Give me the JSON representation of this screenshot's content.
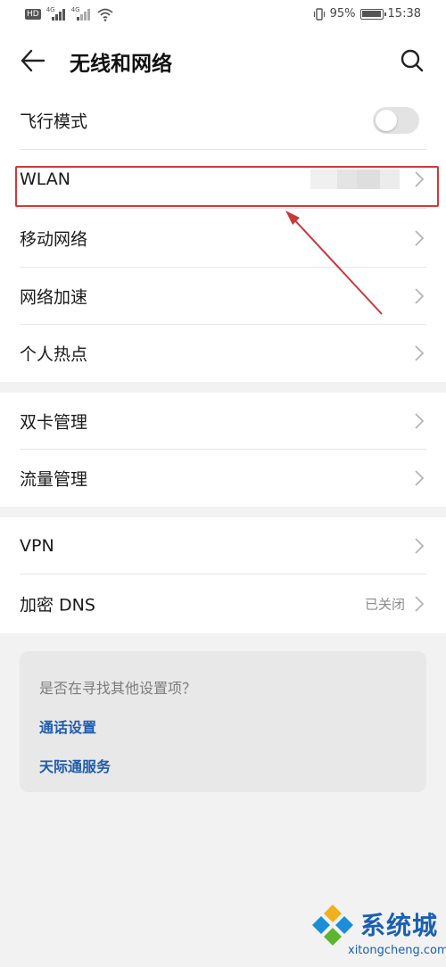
{
  "status_bar": {
    "left_badge": "HD",
    "signal_1": "4G",
    "signal_2": "4G",
    "battery_percent": "95%",
    "time": "15:38"
  },
  "header": {
    "title": "无线和网络"
  },
  "sections": [
    {
      "items": [
        {
          "label": "飞行模式",
          "control": "toggle",
          "toggle_on": false
        },
        {
          "label": "WLAN",
          "control": "chevron"
        },
        {
          "label": "移动网络",
          "control": "chevron"
        },
        {
          "label": "网络加速",
          "control": "chevron"
        },
        {
          "label": "个人热点",
          "control": "chevron"
        }
      ]
    },
    {
      "items": [
        {
          "label": "双卡管理",
          "control": "chevron"
        },
        {
          "label": "流量管理",
          "control": "chevron"
        }
      ]
    },
    {
      "items": [
        {
          "label": "VPN",
          "control": "chevron"
        },
        {
          "label": "加密 DNS",
          "control": "chevron",
          "value": "已关闭"
        }
      ]
    }
  ],
  "suggestions": {
    "question": "是否在寻找其他设置项？",
    "links": [
      "通话设置",
      "天际通服务"
    ]
  },
  "watermark": {
    "brand": "系统城",
    "url": "xitongcheng.com"
  },
  "colors": {
    "highlight": "#d2383b",
    "link": "#1e5cab",
    "watermark": "#1a5fb4"
  },
  "icons": [
    "back-arrow-icon",
    "search-icon",
    "chevron-right-icon",
    "wifi-icon",
    "battery-icon",
    "vibrate-icon"
  ]
}
